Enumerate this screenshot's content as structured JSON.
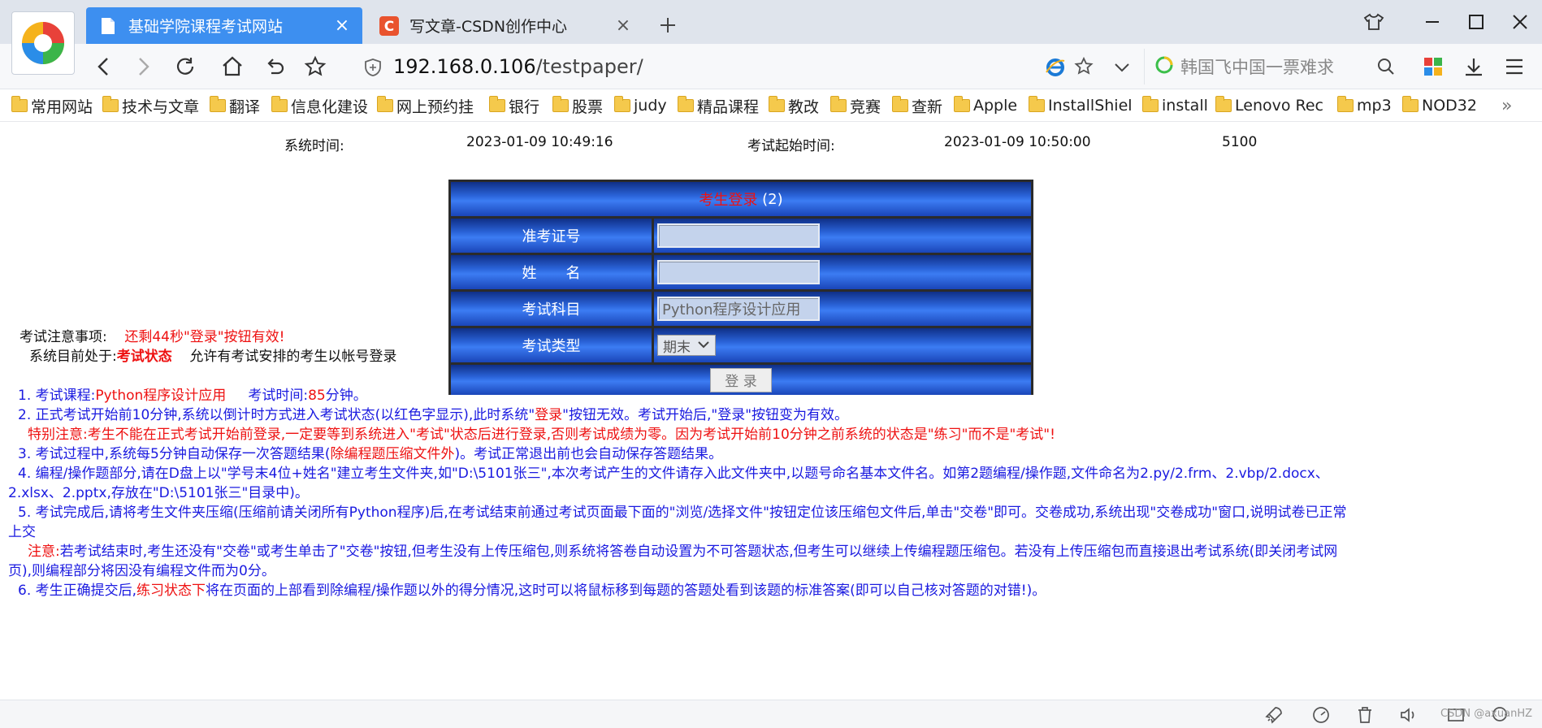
{
  "browser": {
    "tabs": [
      {
        "title": "基础学院课程考试网站",
        "active": true
      },
      {
        "title": "写文章-CSDN创作中心",
        "active": false
      }
    ],
    "address": {
      "host": "192.168.0.106",
      "path": "/testpaper/"
    },
    "search_placeholder": "韩国飞中国一票难求",
    "bookmarks": [
      "常用网站",
      "技术与文章",
      "翻译",
      "信息化建设",
      "网上预约挂",
      "银行",
      "股票",
      "judy",
      "精品课程",
      "教改",
      "竞赛",
      "查新",
      "Apple",
      "InstallShiel",
      "install",
      "Lenovo Rec",
      "mp3",
      "NOD32"
    ],
    "bookmarks_more": "»",
    "colors": {
      "active_tab": "#3d8ff0",
      "csdn": "#e9532e"
    }
  },
  "page": {
    "system_time_label": "系统时间:",
    "system_time": "2023-01-09 10:49:16",
    "exam_start_label": "考试起始时间:",
    "exam_start": "2023-01-09 10:50:00",
    "code": "5100",
    "login": {
      "title": "考生登录",
      "title_suffix": "(2)",
      "ticket_label": "准考证号",
      "ticket_value": "",
      "name_label": "姓　　名",
      "name_value": "",
      "subject_label": "考试科目",
      "subject_value": "Python程序设计应用",
      "type_label": "考试类型",
      "type_value": "期末",
      "submit": "登 录"
    },
    "notes": {
      "heading": "考试注意事项:",
      "countdown": "还剩44秒\"登录\"按钮有效!",
      "status_prefix": "系统目前处于:",
      "status_value": "考试状态",
      "status_desc": "允许有考试安排的考生以帐号登录",
      "item1_a": "1. 考试课程:",
      "item1_course": "Python程序设计应用",
      "item1_b": "考试时间:",
      "item1_minutes": "85",
      "item1_c": "分钟。",
      "item2_a": "2. 正式考试开始前10分钟,系统以倒计时方式进入考试状态(以红色字显示),此时系统\"",
      "item2_red": "登录",
      "item2_b": "\"按钮无效。考试开始后,\"登录\"按钮变为有效。",
      "item2_note": "特别注意:考生不能在正式考试开始前登录,一定要等到系统进入\"考试\"状态后进行登录,否则考试成绩为零。因为考试开始前10分钟之前系统的状态是\"练习\"而不是\"考试\"!",
      "item3_a": "3. 考试过程中,系统每5分钟自动保存一次答题结果(",
      "item3_red": "除编程题压缩文件外",
      "item3_b": ")。考试正常退出前也会自动保存答题结果。",
      "item4": "4. 编程/操作题部分,请在D盘上以\"学号末4位+姓名\"建立考生文件夹,如\"D:\\5101张三\",本次考试产生的文件请存入此文件夹中,以题号命名基本文件名。如第2题编程/操作题,文件命名为2.py/2.frm、2.vbp/2.docx、",
      "item4_cont": "2.xlsx、2.pptx,存放在\"D:\\5101张三\"目录中)。",
      "item5": "5. 考试完成后,请将考生文件夹压缩(压缩前请关闭所有Python程序)后,在考试结束前通过考试页面最下面的\"浏览/选择文件\"按钮定位该压缩包文件后,单击\"交卷\"即可。交卷成功,系统出现\"交卷成功\"窗口,说明试卷已正常",
      "item5_cont": "上交",
      "item5_note_label": "注意:",
      "item5_note": "若考试结束时,考生还没有\"交卷\"或考生单击了\"交卷\"按钮,但考生没有上传压缩包,则系统将答卷自动设置为不可答题状态,但考生可以继续上传编程题压缩包。若没有上传压缩包而直接退出考试系统(即关闭考试网",
      "item5_note_cont": "页),则编程部分将因没有编程文件而为0分。",
      "item6_a": "6. 考生正确提交后,",
      "item6_red": "练习状态下",
      "item6_b": "将在页面的上部看到除编程/操作题以外的得分情况,这时可以将鼠标移到每题的答题处看到该题的标准答案(即可以自己核对答题的对错!)。"
    }
  },
  "statusbar": {
    "watermark": "CSDN @axuanHZ"
  }
}
